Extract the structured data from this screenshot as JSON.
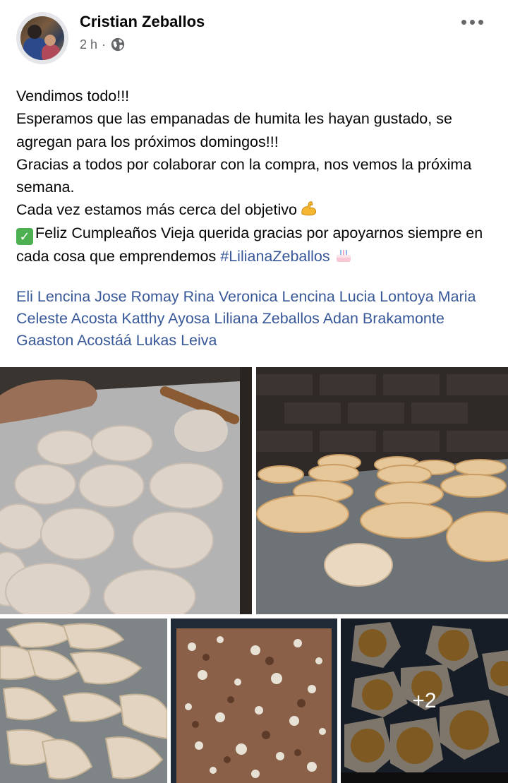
{
  "post": {
    "author": "Cristian Zeballos",
    "time": "2 h",
    "separator": "·",
    "lines": [
      "Vendimos todo!!!",
      "Esperamos que las empanadas de humita les hayan gustado, se agregan para los próximos domingos!!!",
      "Gracias a todos por colaborar con la compra,  nos vemos la próxima semana.",
      "Cada vez estamos más cerca del objetivo"
    ],
    "birthday_line": "Feliz Cumpleaños Vieja querida gracias por apoyarnos siempre en cada cosa que emprendemos",
    "hashtag": "#LilianaZeballos",
    "tags": [
      "Eli Lencina",
      "Jose Romay",
      "Rina Veronica Lencina",
      "Lucia Lontoya",
      "Maria Celeste Acosta",
      "Katthy Ayosa",
      "Liliana Zeballos",
      "Adan Brakamonte",
      "Gaaston Acostáá",
      "Lukas Leiva"
    ]
  },
  "photos": {
    "more_count": "+2"
  },
  "icons": {
    "globe": "globe-icon",
    "more": "more-options-icon",
    "muscle": "flexed-biceps-emoji",
    "check": "check-mark-emoji",
    "cake": "birthday-cake-emoji"
  },
  "colors": {
    "link": "#385898",
    "secondary_text": "#65676b",
    "check_green": "#4cb050"
  }
}
